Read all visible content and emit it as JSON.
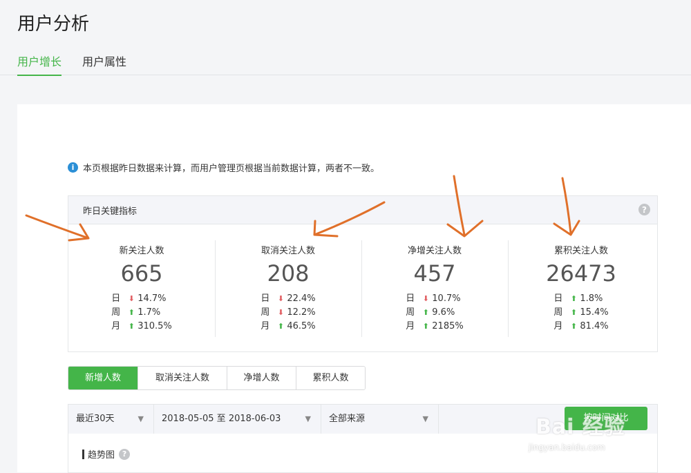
{
  "page": {
    "title": "用户分析"
  },
  "tabs": [
    {
      "label": "用户增长",
      "active": true
    },
    {
      "label": "用户属性",
      "active": false
    }
  ],
  "notice": {
    "icon": "info-icon",
    "text": "本页根据昨日数据来计算，而用户管理页根据当前数据计算，两者不一致。"
  },
  "kpi": {
    "title": "昨日关键指标",
    "help": "?",
    "items": [
      {
        "label": "新关注人数",
        "value": "665",
        "rows": [
          {
            "period": "日",
            "dir": "down",
            "pct": "14.7%"
          },
          {
            "period": "周",
            "dir": "up",
            "pct": "1.7%"
          },
          {
            "period": "月",
            "dir": "up",
            "pct": "310.5%"
          }
        ]
      },
      {
        "label": "取消关注人数",
        "value": "208",
        "rows": [
          {
            "period": "日",
            "dir": "down",
            "pct": "22.4%"
          },
          {
            "period": "周",
            "dir": "down",
            "pct": "12.2%"
          },
          {
            "period": "月",
            "dir": "up",
            "pct": "46.5%"
          }
        ]
      },
      {
        "label": "净增关注人数",
        "value": "457",
        "rows": [
          {
            "period": "日",
            "dir": "down",
            "pct": "10.7%"
          },
          {
            "period": "周",
            "dir": "up",
            "pct": "9.6%"
          },
          {
            "period": "月",
            "dir": "up",
            "pct": "2185%"
          }
        ]
      },
      {
        "label": "累积关注人数",
        "value": "26473",
        "rows": [
          {
            "period": "日",
            "dir": "up",
            "pct": "1.8%"
          },
          {
            "period": "周",
            "dir": "up",
            "pct": "15.4%"
          },
          {
            "period": "月",
            "dir": "up",
            "pct": "81.4%"
          }
        ]
      }
    ]
  },
  "metric_tabs": [
    {
      "label": "新增人数",
      "active": true
    },
    {
      "label": "取消关注人数",
      "active": false
    },
    {
      "label": "净增人数",
      "active": false
    },
    {
      "label": "累积人数",
      "active": false
    }
  ],
  "filters": {
    "period": "最近30天",
    "date_range": "2018-05-05 至 2018-06-03",
    "source": "全部来源",
    "compare_button": "按时间对比"
  },
  "trend": {
    "title": "趋势图",
    "help": "?"
  },
  "watermark": {
    "brand": "Bai 经验",
    "site": "jingyan.baidu.com"
  },
  "colors": {
    "accent": "#44b549",
    "down": "#e15f63",
    "annotation": "#e0702a"
  }
}
